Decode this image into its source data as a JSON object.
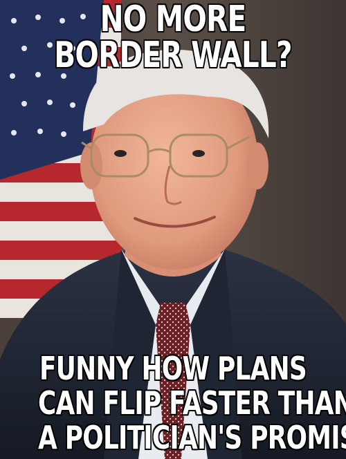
{
  "meme": {
    "top_text": [
      "NO MORE",
      "BORDER WALL?"
    ],
    "bottom_text": [
      "FUNNY HOW PLANS",
      "CAN FLIP FASTER THAN",
      "A POLITICIAN'S PROMISE"
    ]
  }
}
